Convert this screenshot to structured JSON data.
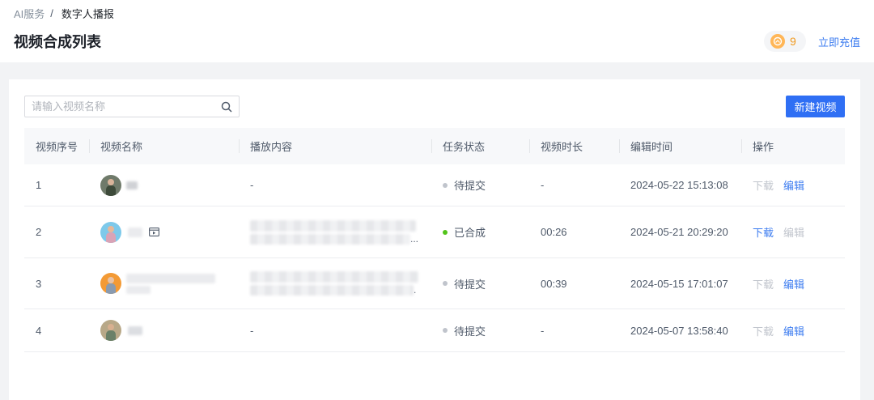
{
  "breadcrumb": {
    "root": "AI服务",
    "separator": "/",
    "current": "数字人播报"
  },
  "page_title": "视频合成列表",
  "coin": {
    "count": "9"
  },
  "recharge_label": "立即充值",
  "search": {
    "placeholder": "请输入视频名称",
    "value": ""
  },
  "new_video_label": "新建视频",
  "table": {
    "columns": [
      "视频序号",
      "视频名称",
      "播放内容",
      "任务状态",
      "视频时长",
      "编辑时间",
      "操作"
    ],
    "rows": [
      {
        "index": "1",
        "content": "-",
        "status": "待提交",
        "status_color": "#c0c4cc",
        "duration": "-",
        "edit_time": "2024-05-22 15:13:08",
        "download_label": "下载",
        "download_enabled": false,
        "edit_label": "编辑",
        "edit_enabled": true
      },
      {
        "index": "2",
        "content": "",
        "content_ellipsis": "...",
        "status": "已合成",
        "status_color": "#52c41a",
        "duration": "00:26",
        "edit_time": "2024-05-21 20:29:20",
        "download_label": "下载",
        "download_enabled": true,
        "edit_label": "编辑",
        "edit_enabled": false
      },
      {
        "index": "3",
        "content": "",
        "content_ellipsis": ".",
        "status": "待提交",
        "status_color": "#c0c4cc",
        "duration": "00:39",
        "edit_time": "2024-05-15 17:01:07",
        "download_label": "下载",
        "download_enabled": false,
        "edit_label": "编辑",
        "edit_enabled": true
      },
      {
        "index": "4",
        "content": "-",
        "status": "待提交",
        "status_color": "#c0c4cc",
        "duration": "-",
        "edit_time": "2024-05-07 13:58:40",
        "download_label": "下载",
        "download_enabled": false,
        "edit_label": "编辑",
        "edit_enabled": true
      }
    ]
  },
  "colors": {
    "primary": "#2f6ff4",
    "link": "#3c7cf0",
    "coin": "#ffb657"
  },
  "icons": {
    "search": "search-icon",
    "coin": "coin-icon",
    "video_badge": "video-preview-icon"
  }
}
